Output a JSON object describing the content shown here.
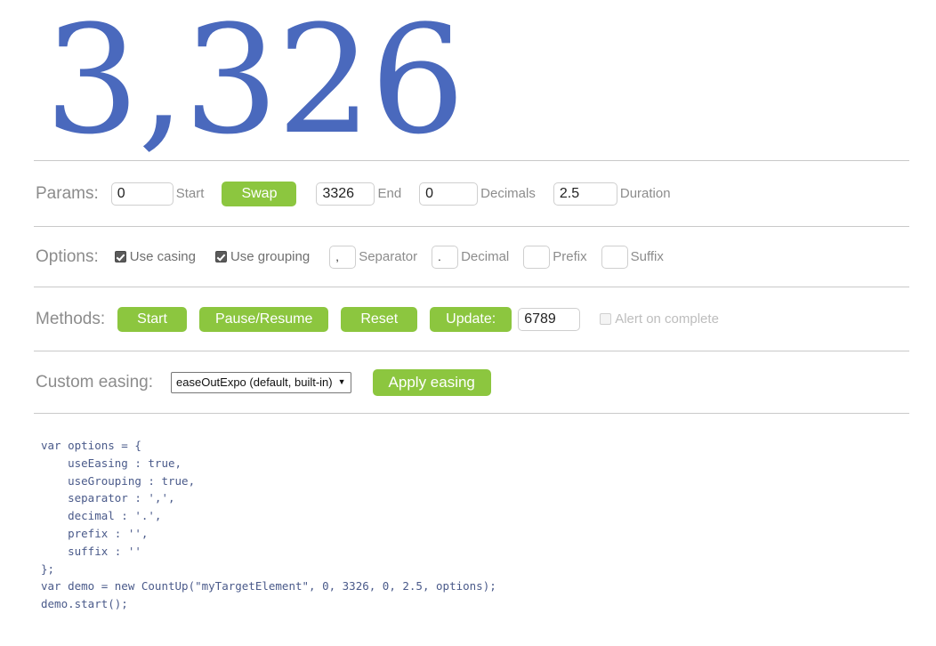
{
  "counter": {
    "value": "3,326",
    "color": "#4a69bd"
  },
  "theme": {
    "green": "#8cc63f",
    "label_gray": "#8c8c8c",
    "rule_gray": "#c9c9c9"
  },
  "params": {
    "label": "Params:",
    "start_value": "0",
    "start_label": "Start",
    "swap_label": "Swap",
    "end_value": "3326",
    "end_label": "End",
    "decimals_value": "0",
    "decimals_label": "Decimals",
    "duration_value": "2.5",
    "duration_label": "Duration"
  },
  "options": {
    "label": "Options:",
    "use_easing_label": "Use casing",
    "use_easing_checked": true,
    "use_grouping_label": "Use grouping",
    "use_grouping_checked": true,
    "separator_value": ",",
    "separator_label": "Separator",
    "decimal_value": ".",
    "decimal_label": "Decimal",
    "prefix_value": "",
    "prefix_label": "Prefix",
    "suffix_value": "",
    "suffix_label": "Suffix"
  },
  "methods": {
    "label": "Methods:",
    "start_label": "Start",
    "pause_resume_label": "Pause/Resume",
    "reset_label": "Reset",
    "update_label": "Update:",
    "update_value": "6789",
    "alert_label": "Alert on complete",
    "alert_checked": false
  },
  "easing": {
    "label": "Custom easing:",
    "selected_option": "easeOutExpo (default, built-in)",
    "apply_label": "Apply easing"
  },
  "code": {
    "text": "var options = {\n    useEasing : true,\n    useGrouping : true,\n    separator : ',',\n    decimal : '.',\n    prefix : '',\n    suffix : ''\n};\nvar demo = new CountUp(\"myTargetElement\", 0, 3326, 0, 2.5, options);\ndemo.start();"
  }
}
